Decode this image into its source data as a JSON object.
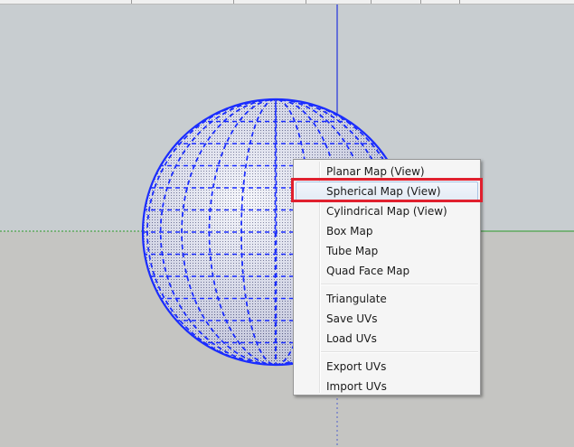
{
  "context_menu": {
    "groups": [
      {
        "items": [
          {
            "label": "Planar Map (View)",
            "name": "menu-item-planar-map"
          },
          {
            "label": "Spherical Map (View)",
            "name": "menu-item-spherical-map",
            "hovered": true
          },
          {
            "label": "Cylindrical Map (View)",
            "name": "menu-item-cylindrical-map"
          },
          {
            "label": "Box Map",
            "name": "menu-item-box-map"
          },
          {
            "label": "Tube Map",
            "name": "menu-item-tube-map"
          },
          {
            "label": "Quad Face Map",
            "name": "menu-item-quad-face-map"
          }
        ]
      },
      {
        "items": [
          {
            "label": "Triangulate",
            "name": "menu-item-triangulate"
          },
          {
            "label": "Save UVs",
            "name": "menu-item-save-uvs"
          },
          {
            "label": "Load UVs",
            "name": "menu-item-load-uvs"
          }
        ]
      },
      {
        "items": [
          {
            "label": "Export UVs",
            "name": "menu-item-export-uvs"
          },
          {
            "label": "Import UVs",
            "name": "menu-item-import-uvs"
          }
        ]
      }
    ]
  },
  "colors": {
    "sky": "#c8cdd0",
    "ground": "#c5c5c2",
    "sphere_edges": "#1a2cff",
    "axis_blue": "#2233dd",
    "axis_green": "#2a9a2a",
    "highlight": "#e0202e"
  }
}
